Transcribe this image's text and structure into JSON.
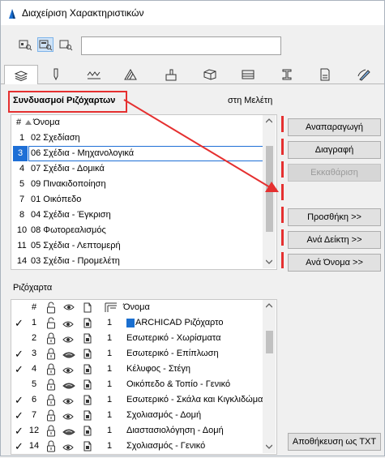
{
  "window": {
    "title": "Διαχείριση Χαρακτηριστικών"
  },
  "toolbar": {
    "buttons": [
      {
        "icon": "layer-view-icon",
        "active": false
      },
      {
        "icon": "layer-view-alt-icon",
        "active": true
      },
      {
        "icon": "layer-view-search-icon",
        "active": false
      }
    ],
    "search_value": ""
  },
  "tabs": [
    {
      "icon": "layers-tab-icon",
      "active": true
    },
    {
      "icon": "pen-tab-icon"
    },
    {
      "icon": "line-tab-icon"
    },
    {
      "icon": "fill-tab-icon"
    },
    {
      "icon": "surface-tab-icon"
    },
    {
      "icon": "building-material-tab-icon"
    },
    {
      "icon": "composite-tab-icon"
    },
    {
      "icon": "profile-tab-icon"
    },
    {
      "icon": "zone-tab-icon"
    },
    {
      "icon": "markup-tab-icon"
    },
    {
      "icon": "graphic-override-tab-icon"
    }
  ],
  "combos": {
    "heading": "Συνδυασμοί Ριζόχαρτων",
    "scope": "στη Μελέτη",
    "col_num": "#",
    "col_name": "Όνομα",
    "items": [
      {
        "num": "1",
        "name": "02 Σχεδίαση"
      },
      {
        "num": "3",
        "name": "06 Σχέδια - Μηχανολογικά",
        "selected": true
      },
      {
        "num": "4",
        "name": "07 Σχέδια - Δομικά"
      },
      {
        "num": "5",
        "name": "09 Πινακιδοποίηση"
      },
      {
        "num": "7",
        "name": "01 Οικόπεδο"
      },
      {
        "num": "8",
        "name": "04 Σχέδια - Έγκριση"
      },
      {
        "num": "10",
        "name": "08 Φωτορεαλισμός"
      },
      {
        "num": "11",
        "name": "05 Σχέδια - Λεπτομερή"
      },
      {
        "num": "14",
        "name": "03 Σχέδια - Προμελέτη"
      }
    ]
  },
  "buttons": {
    "regenerate": "Αναπαραγωγή",
    "delete": "Διαγραφή",
    "purge": "Εκκαθάριση",
    "add": "Προσθήκη >>",
    "by_index": "Ανά Δείκτη >>",
    "by_name": "Ανά Όνομα >>",
    "save_txt": "Αποθήκευση ως TXT"
  },
  "layers": {
    "heading": "Ριζόχαρτα",
    "col_num": "#",
    "col_name": "Όνομα",
    "items": [
      {
        "checked": true,
        "num": "1",
        "locked": false,
        "vis": "eye",
        "pen": "1",
        "name": "ARCHICAD Ριζόχαρτο",
        "archicad_icon": true
      },
      {
        "checked": false,
        "num": "2",
        "locked": true,
        "vis": "eye",
        "pen": "1",
        "name": "Εσωτερικό - Χωρίσματα"
      },
      {
        "checked": true,
        "num": "3",
        "locked": true,
        "vis": "solid",
        "pen": "1",
        "name": "Εσωτερικό - Επίπλωση"
      },
      {
        "checked": true,
        "num": "4",
        "locked": true,
        "vis": "eye",
        "pen": "1",
        "name": "Κέλυφος - Στέγη"
      },
      {
        "checked": false,
        "num": "5",
        "locked": true,
        "vis": "solid",
        "pen": "1",
        "name": "Οικόπεδο & Τοπίο - Γενικό"
      },
      {
        "checked": true,
        "num": "6",
        "locked": true,
        "vis": "eye",
        "pen": "1",
        "name": "Εσωτερικό - Σκάλα και Κιγκλιδώματα"
      },
      {
        "checked": true,
        "num": "7",
        "locked": true,
        "vis": "eye",
        "pen": "1",
        "name": "Σχολιασμός - Δομή"
      },
      {
        "checked": true,
        "num": "12",
        "locked": true,
        "vis": "solid",
        "pen": "1",
        "name": "Διαστασιολόγηση - Δομή"
      },
      {
        "checked": true,
        "num": "14",
        "locked": true,
        "vis": "eye",
        "pen": "1",
        "name": "Σχολιασμός - Γενικό"
      }
    ]
  },
  "colors": {
    "accent": "#1e6fd6",
    "annotation": "#e53030"
  }
}
